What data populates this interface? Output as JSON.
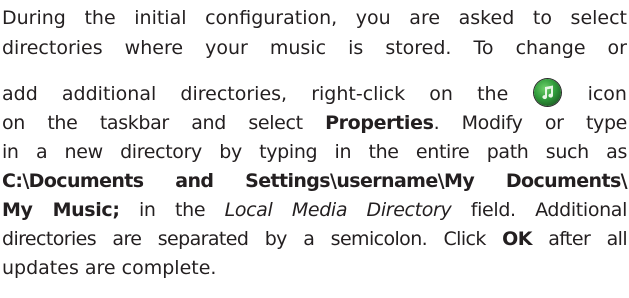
{
  "paragraph": {
    "line1": "During the initial configuration, you are asked to select",
    "line2": "directories where your music is stored. To change or",
    "line3_pre": "add additional directories, right-click on the",
    "line3_post": "icon",
    "line4_pre": "on the taskbar and select ",
    "line4_bold": "Properties",
    "line4_post": ". Modify or type",
    "line5": "in a new directory by typing in the entire path such as",
    "line6_bold": "C:\\Documents and Settings\\username\\My Documents\\",
    "line7_bold": "My Music;",
    "line7_mid": " in the ",
    "line7_italic": "Local Media Directory",
    "line7_post": " field. Additional",
    "line8": "directories are separated by a semicolon. Click ",
    "line8_bold": "OK",
    "line8_post": " after all",
    "line9": "updates are complete."
  },
  "icons": {
    "taskbar_icon": "music-app-icon"
  }
}
